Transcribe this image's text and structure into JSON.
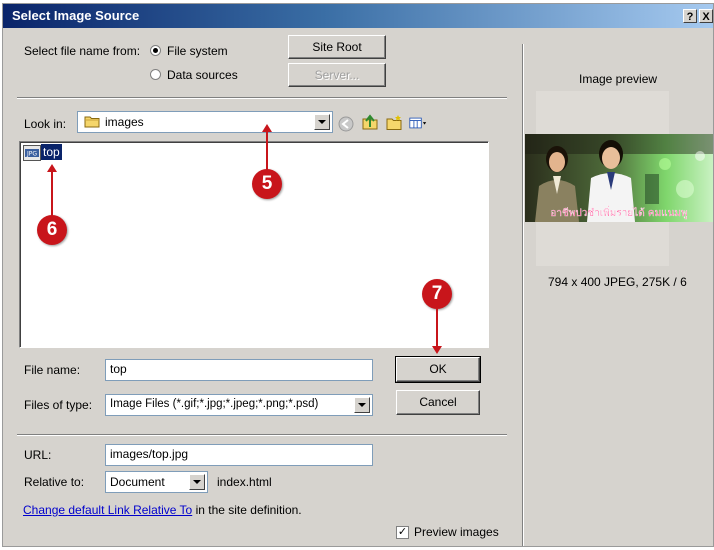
{
  "window": {
    "title": "Select Image Source",
    "help_label": "?",
    "close_label": "X"
  },
  "source": {
    "label": "Select file name from:",
    "options": [
      {
        "label": "File system",
        "selected": true
      },
      {
        "label": "Data sources",
        "selected": false
      }
    ],
    "site_root_label": "Site Root",
    "server_label": "Server..."
  },
  "browser": {
    "look_in_label": "Look in:",
    "folder_name": "images",
    "folder_icon": "folder-icon",
    "files": [
      {
        "name": "top",
        "type_badge": "JPG"
      }
    ]
  },
  "form": {
    "file_name_label": "File name:",
    "file_name_value": "top",
    "file_type_label": "Files of type:",
    "file_type_value": "Image Files (*.gif;*.jpg;*.jpeg;*.png;*.psd)",
    "ok_label": "OK",
    "cancel_label": "Cancel",
    "url_label": "URL:",
    "url_value": "images/top.jpg",
    "relative_label": "Relative to:",
    "relative_value": "Document",
    "relative_file": "index.html",
    "link_text": "Change default Link Relative To",
    "link_suffix": " in the site definition.",
    "preview_check_label": "Preview images",
    "preview_checked": true
  },
  "preview": {
    "title": "Image preview",
    "info": "794 x 400 JPEG, 275K / 6",
    "banner_text": "อาชีพปวชำเพิ่มรายได้ คมแนมพู"
  },
  "annotations": [
    "5",
    "6",
    "7"
  ],
  "colors": {
    "dialog_bg": "#d6d3ce",
    "title_start": "#0a246a",
    "title_end": "#a6caf0",
    "marker": "#c8151b",
    "selection": "#0a246a"
  }
}
